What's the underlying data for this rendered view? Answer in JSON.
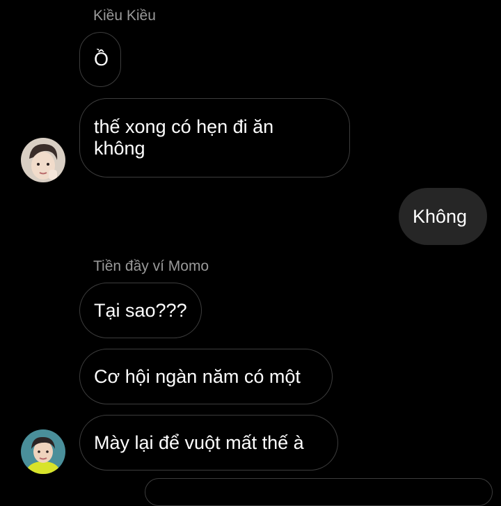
{
  "chat": {
    "group1": {
      "sender": "Kiều Kiều",
      "messages": [
        "Ồ",
        "thế xong có hẹn đi ăn không"
      ]
    },
    "outgoing": {
      "messages": [
        "Không"
      ]
    },
    "group2": {
      "sender": "Tiền đầy ví Momo",
      "messages": [
        "Tại sao???",
        "Cơ hội ngàn năm có một",
        "Mày lại để vuột mất thế à"
      ]
    }
  },
  "colors": {
    "background": "#000000",
    "incoming_border": "#3d3d3d",
    "outgoing_bubble": "#262626",
    "sender_name": "#9a9a9a",
    "text": "#ffffff"
  }
}
